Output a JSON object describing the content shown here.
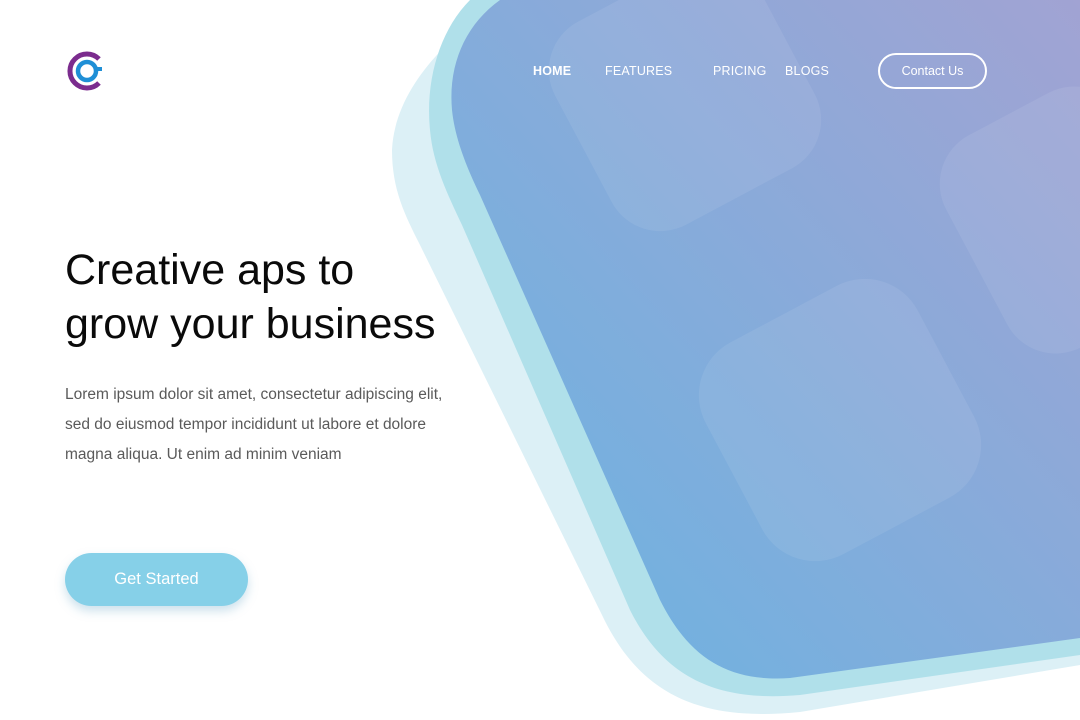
{
  "nav": {
    "items": [
      {
        "label": "HOME",
        "active": true
      },
      {
        "label": "FEATURES",
        "active": false
      },
      {
        "label": "PRICING",
        "active": false
      },
      {
        "label": "BLOGS",
        "active": false
      }
    ],
    "contact_label": "Contact Us"
  },
  "logo": {
    "icon": "c-logo-icon"
  },
  "hero": {
    "title_lines": [
      "Creative aps to",
      "grow your business"
    ],
    "body_lines": [
      "Lorem ipsum dolor sit amet, consectetur adipiscing elit,",
      "sed do eiusmod tempor incididunt ut labore et dolore",
      "magna aliqua. Ut enim ad minim veniam"
    ],
    "cta_label": "Get Started"
  },
  "colors": {
    "shape_gradient_start": "#6fb3e0",
    "shape_gradient_end": "#9aa2d2",
    "shape_layer_light": "#d7eef5",
    "shape_layer_mid": "#aedfe9",
    "cta_background": "#86d0e8",
    "logo_purple": "#7b2c8e",
    "logo_blue": "#1f8fd6",
    "title_text": "#0a0a0a",
    "body_text": "#5a5a5a"
  }
}
